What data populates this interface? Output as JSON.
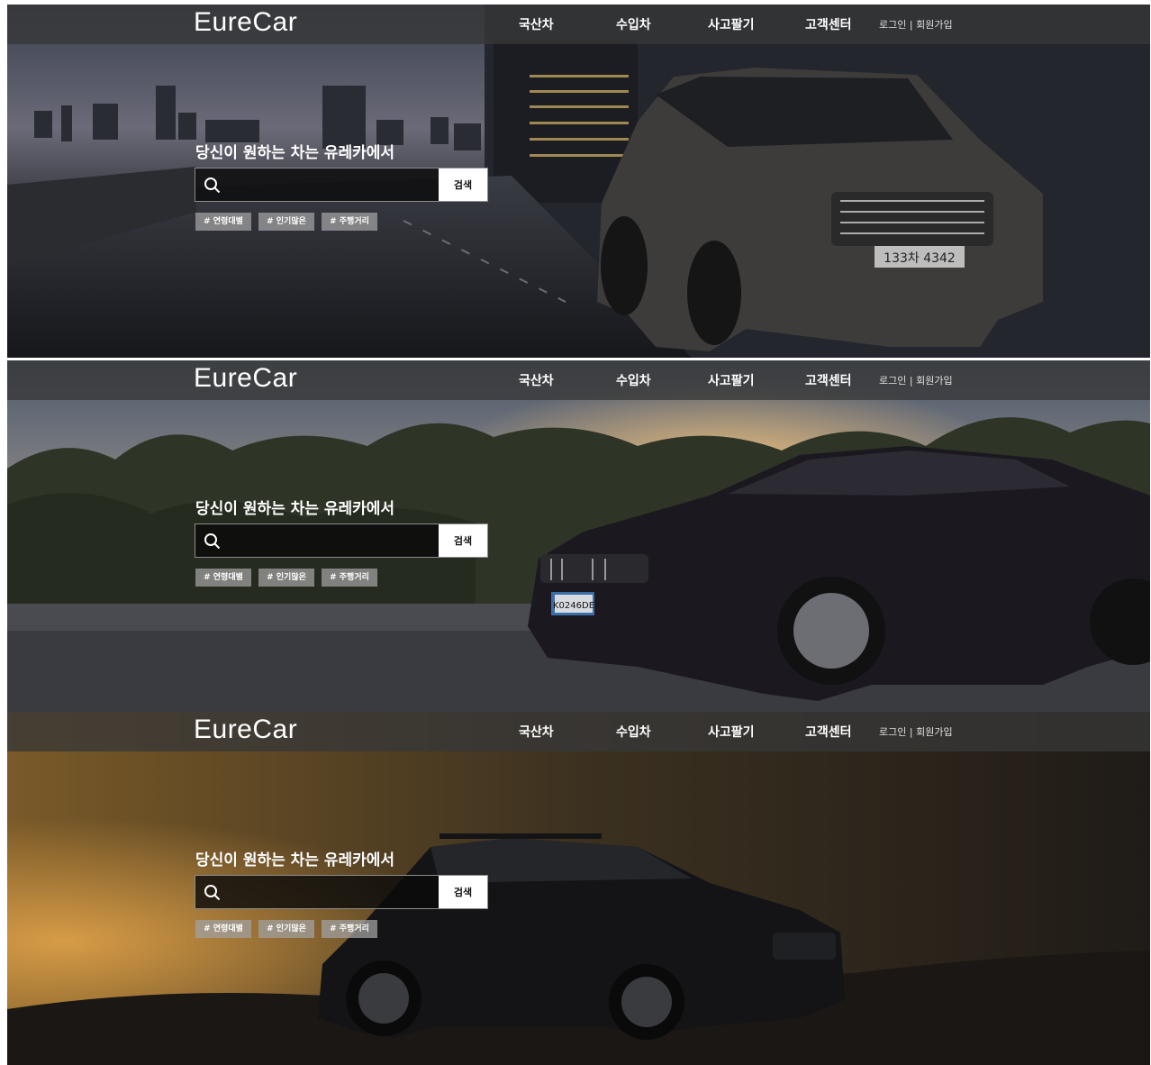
{
  "frames": [
    {
      "logo": "EureCar",
      "nav": [
        "국산차",
        "수입차",
        "사고팔기",
        "고객센터"
      ],
      "auth": {
        "login": "로그인",
        "separator": "|",
        "signup": "회원가입"
      },
      "tagline": "당신이 원하는 차는 유레카에서",
      "search": {
        "placeholder": "",
        "button": "검색"
      },
      "tags": [
        "# 연령대별",
        "# 인기많은",
        "# 주행거리"
      ],
      "plate": "133차 4342"
    },
    {
      "logo": "EureCar",
      "nav": [
        "국산차",
        "수입차",
        "사고팔기",
        "고객센터"
      ],
      "auth": {
        "login": "로그인",
        "separator": "|",
        "signup": "회원가입"
      },
      "tagline": "당신이 원하는 차는 유레카에서",
      "search": {
        "placeholder": "",
        "button": "검색"
      },
      "tags": [
        "# 연령대별",
        "# 인기많은",
        "# 주행거리"
      ],
      "plate": "K0246DE"
    },
    {
      "logo": "EureCar",
      "nav": [
        "국산차",
        "수입차",
        "사고팔기",
        "고객센터"
      ],
      "auth": {
        "login": "로그인",
        "separator": "|",
        "signup": "회원가입"
      },
      "tagline": "당신이 원하는 차는 유레카에서",
      "search": {
        "placeholder": "",
        "button": "검색"
      },
      "tags": [
        "# 연령대별",
        "# 인기많은",
        "# 주행거리"
      ]
    }
  ],
  "colors": {
    "nav_bg": "#373737",
    "search_bg": "#0a0a0a",
    "search_button_bg": "#ffffff",
    "tag_bg": "#a0a0a0",
    "text": "#ffffff"
  }
}
